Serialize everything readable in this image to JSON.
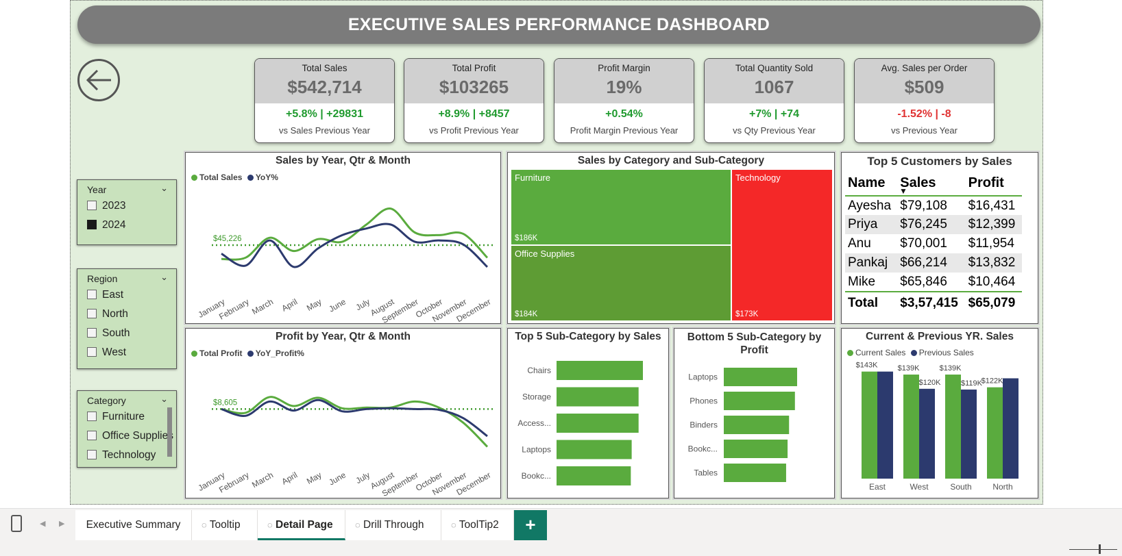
{
  "title": "EXECUTIVE SALES PERFORMANCE DASHBOARD",
  "kpis": [
    {
      "label": "Total Sales",
      "value": "$542,714",
      "change": "+5.8% | +29831",
      "sub": "vs Sales Previous Year",
      "change_color": "#1f9a2e"
    },
    {
      "label": "Total Profit",
      "value": "$103265",
      "change": "+8.9% | +8457",
      "sub": "vs Profit Previous Year",
      "change_color": "#1f9a2e"
    },
    {
      "label": "Profit Margin",
      "value": "19%",
      "change": "+0.54%",
      "sub": "Profit Margin Previous Year",
      "change_color": "#1f9a2e"
    },
    {
      "label": "Total Quantity Sold",
      "value": "1067",
      "change": "+7% | +74",
      "sub": "vs Qty Previous Year",
      "change_color": "#1f9a2e"
    },
    {
      "label": "Avg. Sales per Order",
      "value": "$509",
      "change": "-1.52% | -8",
      "sub": "vs Previous Year",
      "change_color": "#e03232"
    }
  ],
  "slicers": {
    "year": {
      "title": "Year",
      "items": [
        {
          "label": "2023",
          "checked": false
        },
        {
          "label": "2024",
          "checked": true
        }
      ]
    },
    "region": {
      "title": "Region",
      "items": [
        {
          "label": "East",
          "checked": false
        },
        {
          "label": "North",
          "checked": false
        },
        {
          "label": "South",
          "checked": false
        },
        {
          "label": "West",
          "checked": false
        }
      ]
    },
    "category": {
      "title": "Category",
      "items": [
        {
          "label": "Furniture",
          "checked": false
        },
        {
          "label": "Office Supplies",
          "checked": false
        },
        {
          "label": "Technology",
          "checked": false
        }
      ]
    }
  },
  "customers": {
    "title": "Top 5 Customers by Sales",
    "headers": [
      "Name",
      "Sales",
      "Profit"
    ],
    "rows": [
      [
        "Ayesha",
        "$79,108",
        "$16,431"
      ],
      [
        "Priya",
        "$76,245",
        "$12,399"
      ],
      [
        "Anu",
        "$70,001",
        "$11,954"
      ],
      [
        "Pankaj",
        "$66,214",
        "$13,832"
      ],
      [
        "Mike",
        "$65,846",
        "$10,464"
      ]
    ],
    "total": [
      "Total",
      "$3,57,415",
      "$65,079"
    ]
  },
  "tabs": {
    "t1": "Executive Summary",
    "t2": "Tooltip",
    "t3": "Detail Page",
    "t4": "Drill Through",
    "t5": "ToolTip2",
    "add": "+"
  },
  "colors": {
    "green": "#5aab3e",
    "navy": "#2c3a6e",
    "red": "#f42828",
    "dark_green": "#5e9c34"
  },
  "chart_data": [
    {
      "type": "line",
      "title": "Sales by Year, Qtr & Month",
      "x": [
        "January",
        "February",
        "March",
        "April",
        "May",
        "June",
        "July",
        "August",
        "September",
        "October",
        "November",
        "December"
      ],
      "series": [
        {
          "name": "Total Sales",
          "values": [
            40000,
            40500,
            48000,
            43000,
            47500,
            46500,
            53000,
            59000,
            50000,
            49000,
            49500,
            40500
          ]
        },
        {
          "name": "YoY%",
          "values": [
            42000,
            37500,
            47000,
            37000,
            44000,
            49000,
            51500,
            53000,
            46500,
            47000,
            45500,
            37000
          ]
        }
      ],
      "reference_line": {
        "label": "$45,226",
        "value": 45226
      },
      "ylim": [
        30000,
        62000
      ]
    },
    {
      "type": "line",
      "title": "Profit by Year, Qtr & Month",
      "x": [
        "January",
        "February",
        "March",
        "April",
        "May",
        "June",
        "July",
        "August",
        "September",
        "October",
        "November",
        "December"
      ],
      "series": [
        {
          "name": "Total Profit",
          "values": [
            8600,
            8100,
            10200,
            9000,
            10100,
            8700,
            8800,
            8800,
            9600,
            8800,
            6800,
            3600
          ]
        },
        {
          "name": "YoY_Profit%",
          "values": [
            8600,
            7700,
            9600,
            8400,
            9800,
            8300,
            8600,
            8700,
            8600,
            8500,
            7400,
            5000
          ]
        }
      ],
      "reference_line": {
        "label": "$8,605",
        "value": 8605
      },
      "ylim": [
        2000,
        12000
      ]
    },
    {
      "type": "treemap",
      "title": "Sales by Category and Sub-Category",
      "categories": [
        "Furniture",
        "Office Supplies",
        "Technology"
      ],
      "values": [
        186,
        184,
        173
      ],
      "value_labels": [
        "$186K",
        "$184K",
        "$173K"
      ]
    },
    {
      "type": "bar",
      "title": "Top 5 Sub-Category by Sales",
      "categories": [
        "Chairs",
        "Storage",
        "Access...",
        "Laptops",
        "Bookc..."
      ],
      "values": [
        100,
        95,
        95,
        87,
        86
      ]
    },
    {
      "type": "bar",
      "title": "Bottom 5 Sub-Category by Profit",
      "categories": [
        "Laptops",
        "Phones",
        "Binders",
        "Bookc...",
        "Tables"
      ],
      "values": [
        100,
        97,
        89,
        87,
        85
      ]
    },
    {
      "type": "bar",
      "title": "Current & Previous YR. Sales",
      "categories": [
        "East",
        "West",
        "South",
        "North"
      ],
      "series": [
        {
          "name": "Current Sales",
          "values": [
            143,
            139,
            139,
            122
          ],
          "labels": [
            "$143K",
            "$139K",
            "$139K",
            "$122K"
          ]
        },
        {
          "name": "Previous Sales",
          "values": [
            143,
            120,
            119,
            134
          ],
          "labels": [
            "",
            "$120K",
            "$119K",
            ""
          ]
        }
      ],
      "ylim": [
        0,
        150
      ]
    }
  ]
}
